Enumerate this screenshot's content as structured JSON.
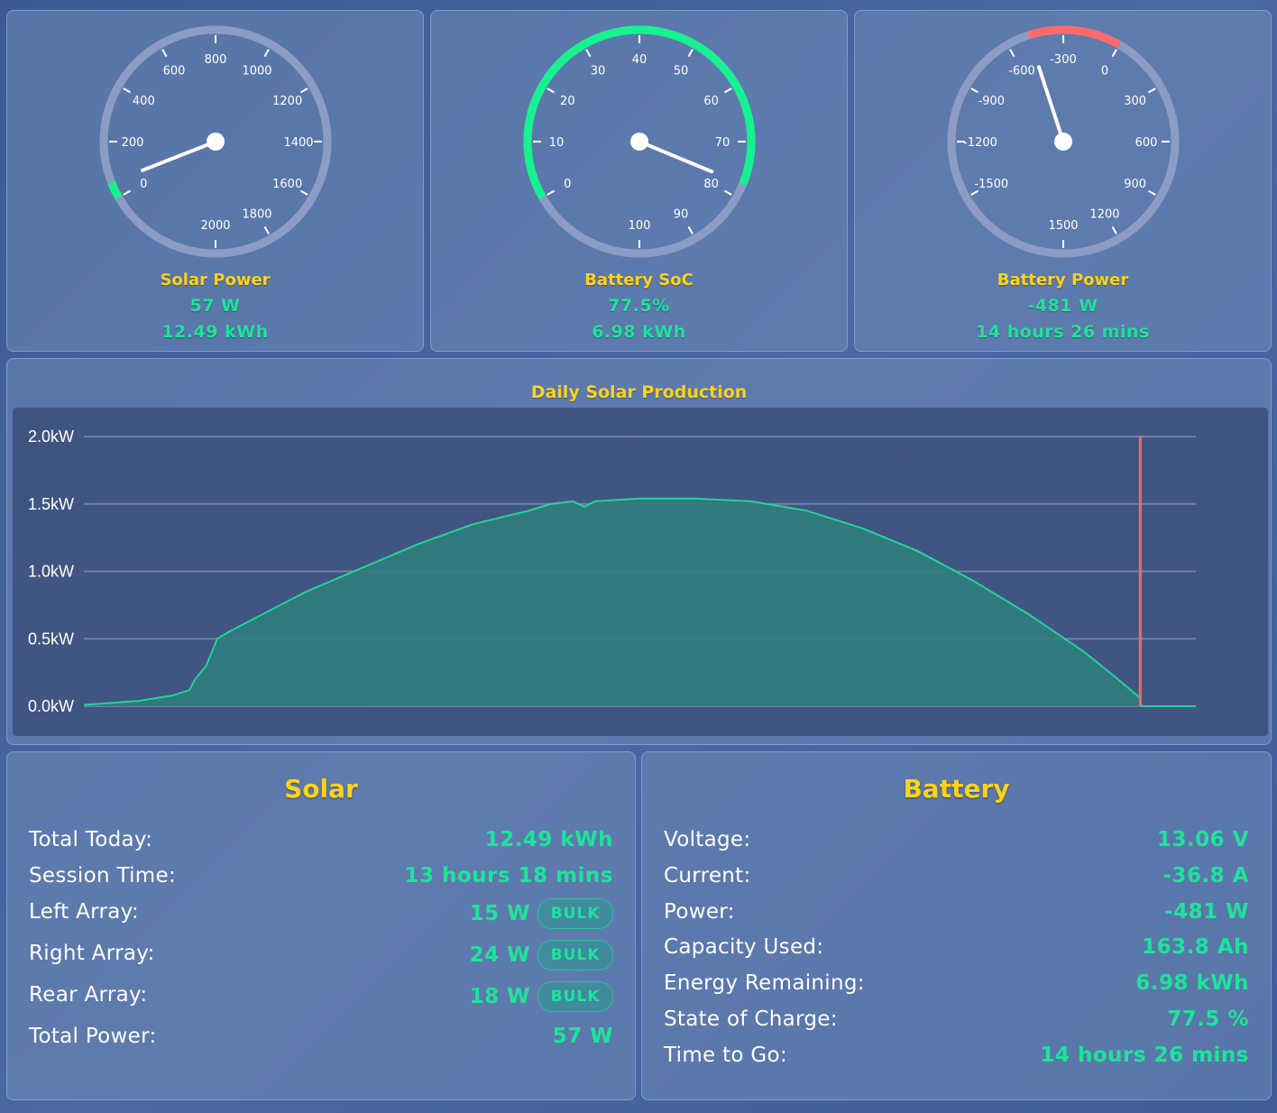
{
  "colors": {
    "accent_yellow": "#ffd21a",
    "value_green": "#1ee39a",
    "gauge_track": "#8c9cc4",
    "gauge_green": "#16f28f",
    "gauge_red": "#fa6a6a",
    "chart_fill": "#2f7d7c",
    "chart_line": "#25d39a",
    "now_marker": "#f26a6a"
  },
  "gauges": [
    {
      "title": "Solar Power",
      "value": "57 W",
      "secondary": "12.49 kWh",
      "min": 0,
      "max": 2000,
      "reading": 57,
      "ticks": [
        "0",
        "200",
        "400",
        "600",
        "800",
        "1000",
        "1200",
        "1400",
        "1600",
        "1800",
        "2000"
      ]
    },
    {
      "title": "Battery SoC",
      "value": "77.5%",
      "secondary": "6.98 kWh",
      "min": 0,
      "max": 100,
      "reading": 77.5,
      "ticks": [
        "0",
        "10",
        "20",
        "30",
        "40",
        "50",
        "60",
        "70",
        "80",
        "90",
        "100"
      ]
    },
    {
      "title": "Battery Power",
      "value": "-481 W",
      "secondary": "14 hours 26 mins",
      "min": -1500,
      "max": 1500,
      "reading": -481,
      "ticks": [
        "-1500",
        "-1200",
        "-900",
        "-600",
        "-300",
        "0",
        "300",
        "600",
        "900",
        "1200",
        "1500"
      ]
    }
  ],
  "chart_data": {
    "type": "area",
    "title": "Daily Solar Production",
    "ylim": [
      0,
      2.0
    ],
    "yticks": [
      "0.0kW",
      "0.5kW",
      "1.0kW",
      "1.5kW",
      "2.0kW"
    ],
    "grid": true,
    "now_fraction": 0.95,
    "x": [
      0,
      0.05,
      0.08,
      0.095,
      0.1,
      0.11,
      0.12,
      0.13,
      0.2,
      0.3,
      0.35,
      0.4,
      0.42,
      0.44,
      0.45,
      0.46,
      0.48,
      0.5,
      0.55,
      0.6,
      0.65,
      0.7,
      0.75,
      0.8,
      0.85,
      0.9,
      0.93,
      0.95,
      0.951,
      1.0
    ],
    "values": [
      0.01,
      0.04,
      0.08,
      0.12,
      0.2,
      0.3,
      0.5,
      0.55,
      0.85,
      1.2,
      1.35,
      1.45,
      1.5,
      1.52,
      1.48,
      1.52,
      1.53,
      1.54,
      1.54,
      1.52,
      1.45,
      1.32,
      1.15,
      0.93,
      0.68,
      0.4,
      0.2,
      0.06,
      0.0,
      0.0
    ]
  },
  "solar": {
    "title": "Solar",
    "rows": [
      {
        "label": "Total Today:",
        "value": "12.49 kWh",
        "badge": ""
      },
      {
        "label": "Session Time:",
        "value": "13 hours 18 mins",
        "badge": ""
      },
      {
        "label": "Left Array:",
        "value": "15 W",
        "badge": "BULK"
      },
      {
        "label": "Right Array:",
        "value": "24 W",
        "badge": "BULK"
      },
      {
        "label": "Rear Array:",
        "value": "18 W",
        "badge": "BULK"
      },
      {
        "label": "Total Power:",
        "value": "57 W",
        "badge": ""
      }
    ]
  },
  "battery": {
    "title": "Battery",
    "rows": [
      {
        "label": "Voltage:",
        "value": "13.06 V"
      },
      {
        "label": "Current:",
        "value": "-36.8 A"
      },
      {
        "label": "Power:",
        "value": "-481 W"
      },
      {
        "label": "Capacity Used:",
        "value": "163.8 Ah"
      },
      {
        "label": "Energy Remaining:",
        "value": "6.98 kWh"
      },
      {
        "label": "State of Charge:",
        "value": "77.5 %"
      },
      {
        "label": "Time to Go:",
        "value": "14 hours 26 mins"
      }
    ]
  }
}
